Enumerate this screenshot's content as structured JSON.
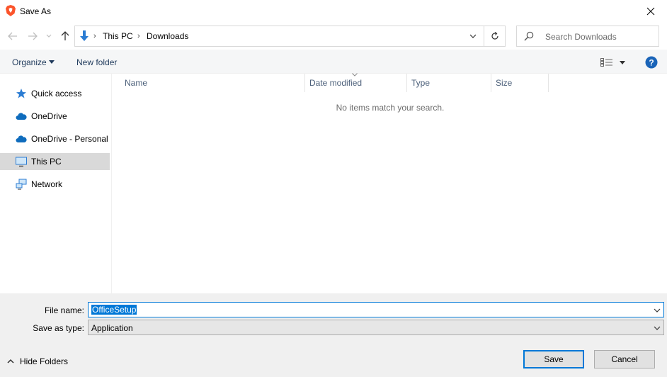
{
  "window": {
    "title": "Save As"
  },
  "nav": {
    "breadcrumb": [
      "This PC",
      "Downloads"
    ],
    "search_placeholder": "Search Downloads"
  },
  "toolbar": {
    "organize_label": "Organize",
    "new_folder_label": "New folder"
  },
  "sidebar": {
    "items": [
      {
        "label": "Quick access",
        "icon": "star-icon"
      },
      {
        "label": "OneDrive",
        "icon": "cloud-icon"
      },
      {
        "label": "OneDrive - Personal",
        "icon": "cloud-icon"
      },
      {
        "label": "This PC",
        "icon": "computer-icon",
        "selected": true
      },
      {
        "label": "Network",
        "icon": "network-icon"
      }
    ]
  },
  "content": {
    "columns": [
      "Name",
      "Date modified",
      "Type",
      "Size"
    ],
    "empty_message": "No items match your search."
  },
  "form": {
    "file_name_label": "File name:",
    "file_name_value": "OfficeSetup",
    "save_type_label": "Save as type:",
    "save_type_value": "Application"
  },
  "footer": {
    "hide_folders_label": "Hide Folders",
    "save_label": "Save",
    "cancel_label": "Cancel"
  },
  "colors": {
    "accent": "#0078d7",
    "toolbar_bg": "#f5f6f7",
    "bottom_bg": "#f0f0f0"
  }
}
